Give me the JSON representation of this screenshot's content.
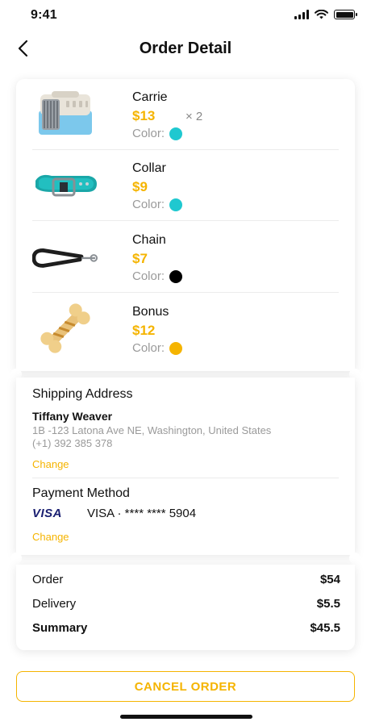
{
  "status_bar": {
    "time": "9:41"
  },
  "header": {
    "title": "Order Detail"
  },
  "products": [
    {
      "name": "Carrie",
      "price": "$13",
      "qty": "× 2",
      "color_label": "Color:",
      "color": "#1fc8d0",
      "icon": "pet-carrier-image"
    },
    {
      "name": "Collar",
      "price": "$9",
      "qty": "",
      "color_label": "Color:",
      "color": "#1fc8d0",
      "icon": "dog-collar-image"
    },
    {
      "name": "Chain",
      "price": "$7",
      "qty": "",
      "color_label": "Color:",
      "color": "#000000",
      "icon": "leash-chain-image"
    },
    {
      "name": "Bonus",
      "price": "$12",
      "qty": "",
      "color_label": "Color:",
      "color": "#f5b400",
      "icon": "bone-treat-image"
    }
  ],
  "shipping": {
    "title": "Shipping Address",
    "name": "Tiffany Weaver",
    "address": "1B -123 Latona Ave NE, Washington, United States",
    "phone": "(+1) 392 385 378",
    "change_label": "Change"
  },
  "payment": {
    "title": "Payment Method",
    "card_brand": "VISA",
    "card_text": "VISA · **** **** 5904",
    "change_label": "Change"
  },
  "totals": {
    "order_label": "Order",
    "order_value": "$54",
    "delivery_label": "Delivery",
    "delivery_value": "$5.5",
    "summary_label": "Summary",
    "summary_value": "$45.5"
  },
  "cancel_button": "CANCEL ORDER",
  "colors": {
    "accent": "#f5b400",
    "teal": "#1fc8d0",
    "text": "#111111",
    "muted": "#9a9a9a"
  }
}
